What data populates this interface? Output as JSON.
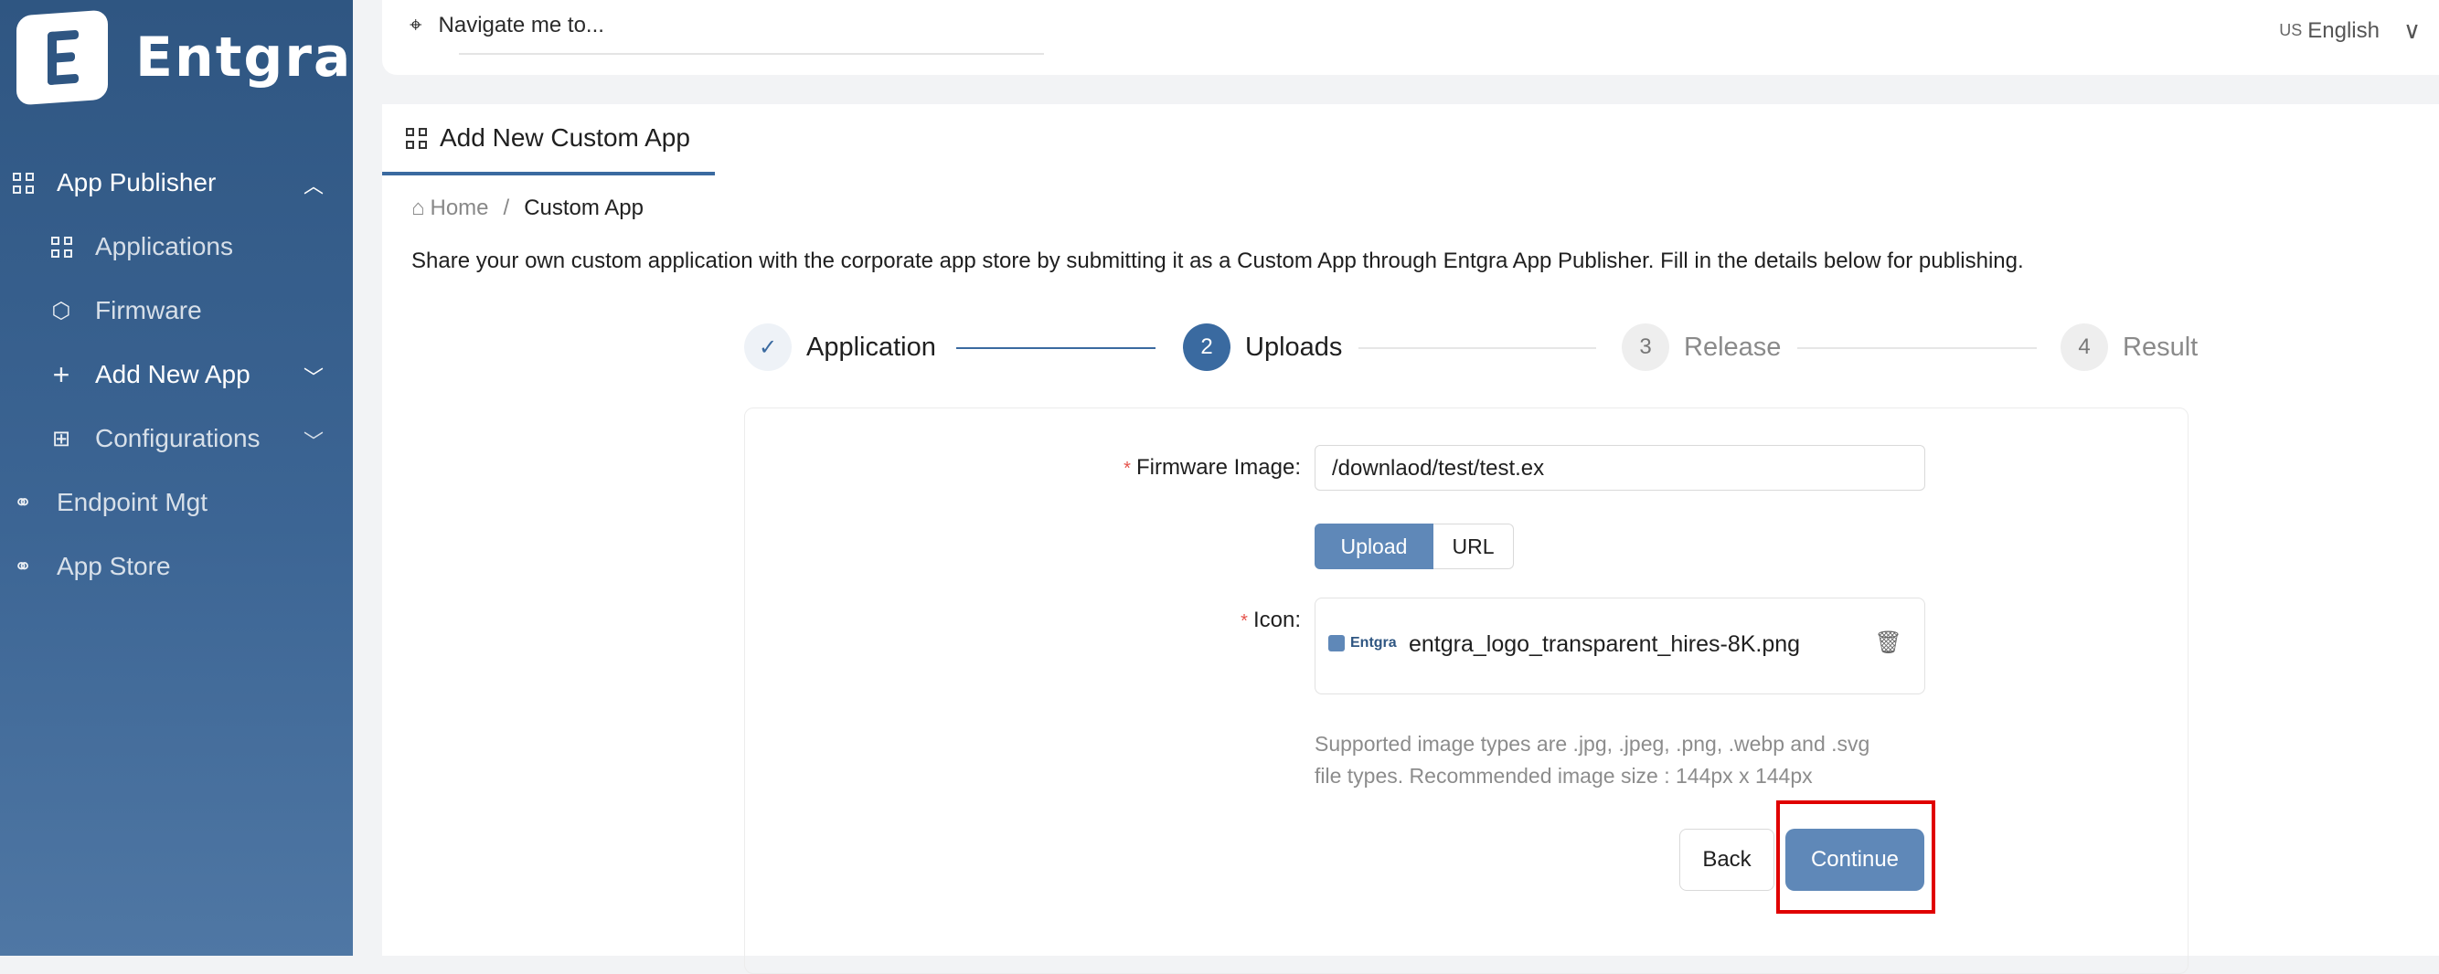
{
  "brand": {
    "name": "Entgra"
  },
  "sidebar": {
    "items": [
      {
        "label": "App Publisher",
        "icon": "grid-icon"
      },
      {
        "label": "Applications",
        "icon": "grid-icon"
      },
      {
        "label": "Firmware",
        "icon": "cube-icon"
      },
      {
        "label": "Add New App",
        "icon": "plus-icon"
      },
      {
        "label": "Configurations",
        "icon": "sliders-icon"
      },
      {
        "label": "Endpoint Mgt",
        "icon": "link-icon"
      },
      {
        "label": "App Store",
        "icon": "link-icon"
      }
    ]
  },
  "topbar": {
    "navigate_placeholder": "Navigate me to...",
    "lang_flag": "US",
    "language": "English"
  },
  "tab": {
    "label": "Add New Custom App"
  },
  "breadcrumb": {
    "home": "Home",
    "separator": "/",
    "current": "Custom App"
  },
  "intro": "Share your own custom application with the corporate app store by submitting it as a Custom App through Entgra App Publisher. Fill in the details below for publishing.",
  "steps": [
    {
      "number": "",
      "label": "Application",
      "state": "done"
    },
    {
      "number": "2",
      "label": "Uploads",
      "state": "active"
    },
    {
      "number": "3",
      "label": "Release",
      "state": "todo"
    },
    {
      "number": "4",
      "label": "Result",
      "state": "todo"
    }
  ],
  "form": {
    "firmware_label": "Firmware Image",
    "firmware_value": "/downlaod/test/test.ex",
    "source_options": [
      "Upload",
      "URL"
    ],
    "icon_label": "Icon",
    "icon_thumb_text": "Entgra",
    "icon_filename": "entgra_logo_transparent_hires-8K.png",
    "help_line1": "Supported image types are .jpg, .jpeg, .png, .webp and .svg",
    "help_line2": "file types. Recommended image size : 144px x 144px",
    "back_label": "Back",
    "continue_label": "Continue"
  },
  "colors": {
    "accent": "#3a6aa0",
    "button": "#5f88b8",
    "highlight": "#e00000",
    "required": "#e5534b"
  }
}
